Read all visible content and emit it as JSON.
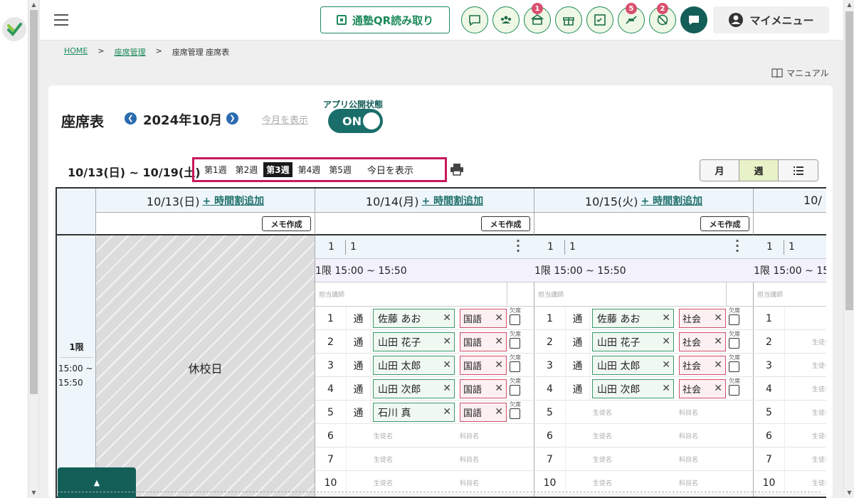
{
  "header": {
    "qr_button": "通塾QR読み取り",
    "icons": [
      "chat-icon",
      "students-icon",
      "school-icon",
      "gift-icon",
      "checklist-icon",
      "transfer-icon",
      "no-location-icon"
    ],
    "badges": {
      "school": "1",
      "transfer": "5",
      "no_location": "2"
    },
    "my_menu": "マイメニュー"
  },
  "breadcrumb": {
    "home": "HOME",
    "seat_mgmt": "座席管理",
    "sep": ">",
    "current": "座席管理 座席表"
  },
  "manual": "マニュアル",
  "page": {
    "title": "座席表",
    "month": "2024年10月",
    "this_month": "今月を表示",
    "app_status_label": "アプリ公開状態",
    "toggle": "ON",
    "week_range": "10/13(日) ~ 10/19(土)",
    "weeks": [
      "第1週",
      "第2週",
      "第3週",
      "第4週",
      "第5週"
    ],
    "active_week": "第3週",
    "today": "今日を表示",
    "views": {
      "month": "月",
      "week": "週"
    }
  },
  "grid": {
    "add_period": "+ 時間割追加",
    "memo": "メモ作成",
    "period": {
      "name": "1限",
      "start": "15:00 ~",
      "end": "15:50",
      "label": "1限 15:00 ~ 15:50"
    },
    "holiday": "休校日",
    "room": {
      "no": "1",
      "name": "1"
    },
    "teacher_ph": "担当講師",
    "student_ph": "生徒名",
    "subject_ph": "科目名",
    "absent": "欠席",
    "type_label": "通",
    "days": [
      {
        "label": "10/13(日)"
      },
      {
        "label": "10/14(月)",
        "subject": "国語",
        "students": [
          "佐藤 あお",
          "山田 花子",
          "山田 太郎",
          "山田 次郎",
          "石川 真"
        ]
      },
      {
        "label": "10/15(火)",
        "subject": "社会",
        "students": [
          "佐藤 あお",
          "山田 花子",
          "山田 太郎",
          "山田 次郎"
        ]
      },
      {
        "label": "10/"
      }
    ],
    "seat_numbers": [
      "1",
      "2",
      "3",
      "4",
      "5",
      "6",
      "7",
      "10"
    ]
  }
}
